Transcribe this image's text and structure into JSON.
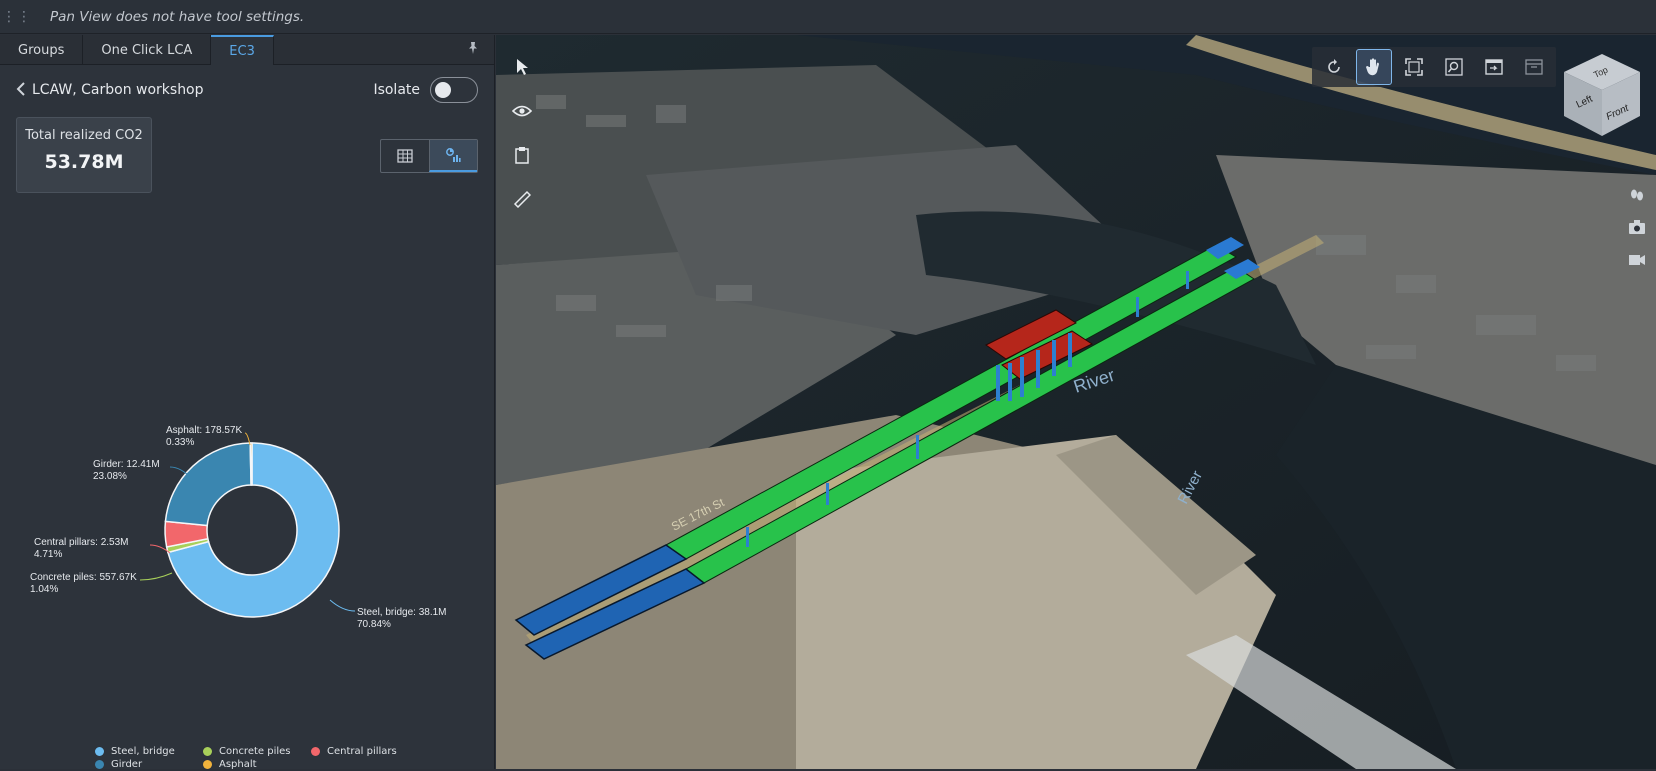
{
  "tool_settings": {
    "message": "Pan View does not have tool settings."
  },
  "tabs": [
    {
      "label": "Groups"
    },
    {
      "label": "One Click LCA"
    },
    {
      "label": "EC3"
    }
  ],
  "panel": {
    "model_name": "LCAW, Carbon workshop",
    "isolate_label": "Isolate",
    "isolate_on": false,
    "co2_label": "Total realized CO2",
    "co2_value": "53.78M"
  },
  "chart_data": {
    "type": "pie",
    "donut": true,
    "slices": [
      {
        "name": "Steel, bridge",
        "label": "Steel, bridge: 38.1M",
        "pct_label": "70.84%",
        "value": 70.84,
        "color": "#6cbcf0"
      },
      {
        "name": "Concrete piles",
        "label": "Concrete piles: 557.67K",
        "pct_label": "1.04%",
        "value": 1.04,
        "color": "#a8d05a"
      },
      {
        "name": "Central pillars",
        "label": "Central pillars: 2.53M",
        "pct_label": "4.71%",
        "value": 4.71,
        "color": "#f2676b"
      },
      {
        "name": "Girder",
        "label": "Girder: 12.41M",
        "pct_label": "23.08%",
        "value": 23.08,
        "color": "#3a86b0"
      },
      {
        "name": "Asphalt",
        "label": "Asphalt: 178.57K",
        "pct_label": "0.33%",
        "value": 0.33,
        "color": "#f1b33c"
      }
    ],
    "legend": [
      [
        "Steel, bridge",
        "Concrete piles",
        "Central pillars"
      ],
      [
        "Girder",
        "Asphalt"
      ]
    ],
    "legend_placement": "bottom"
  },
  "map_labels": {
    "river_1": "River",
    "river_2": "River",
    "street_1": "SE 17th St"
  },
  "cube": {
    "top": "Top",
    "left": "Left",
    "front": "Front"
  }
}
